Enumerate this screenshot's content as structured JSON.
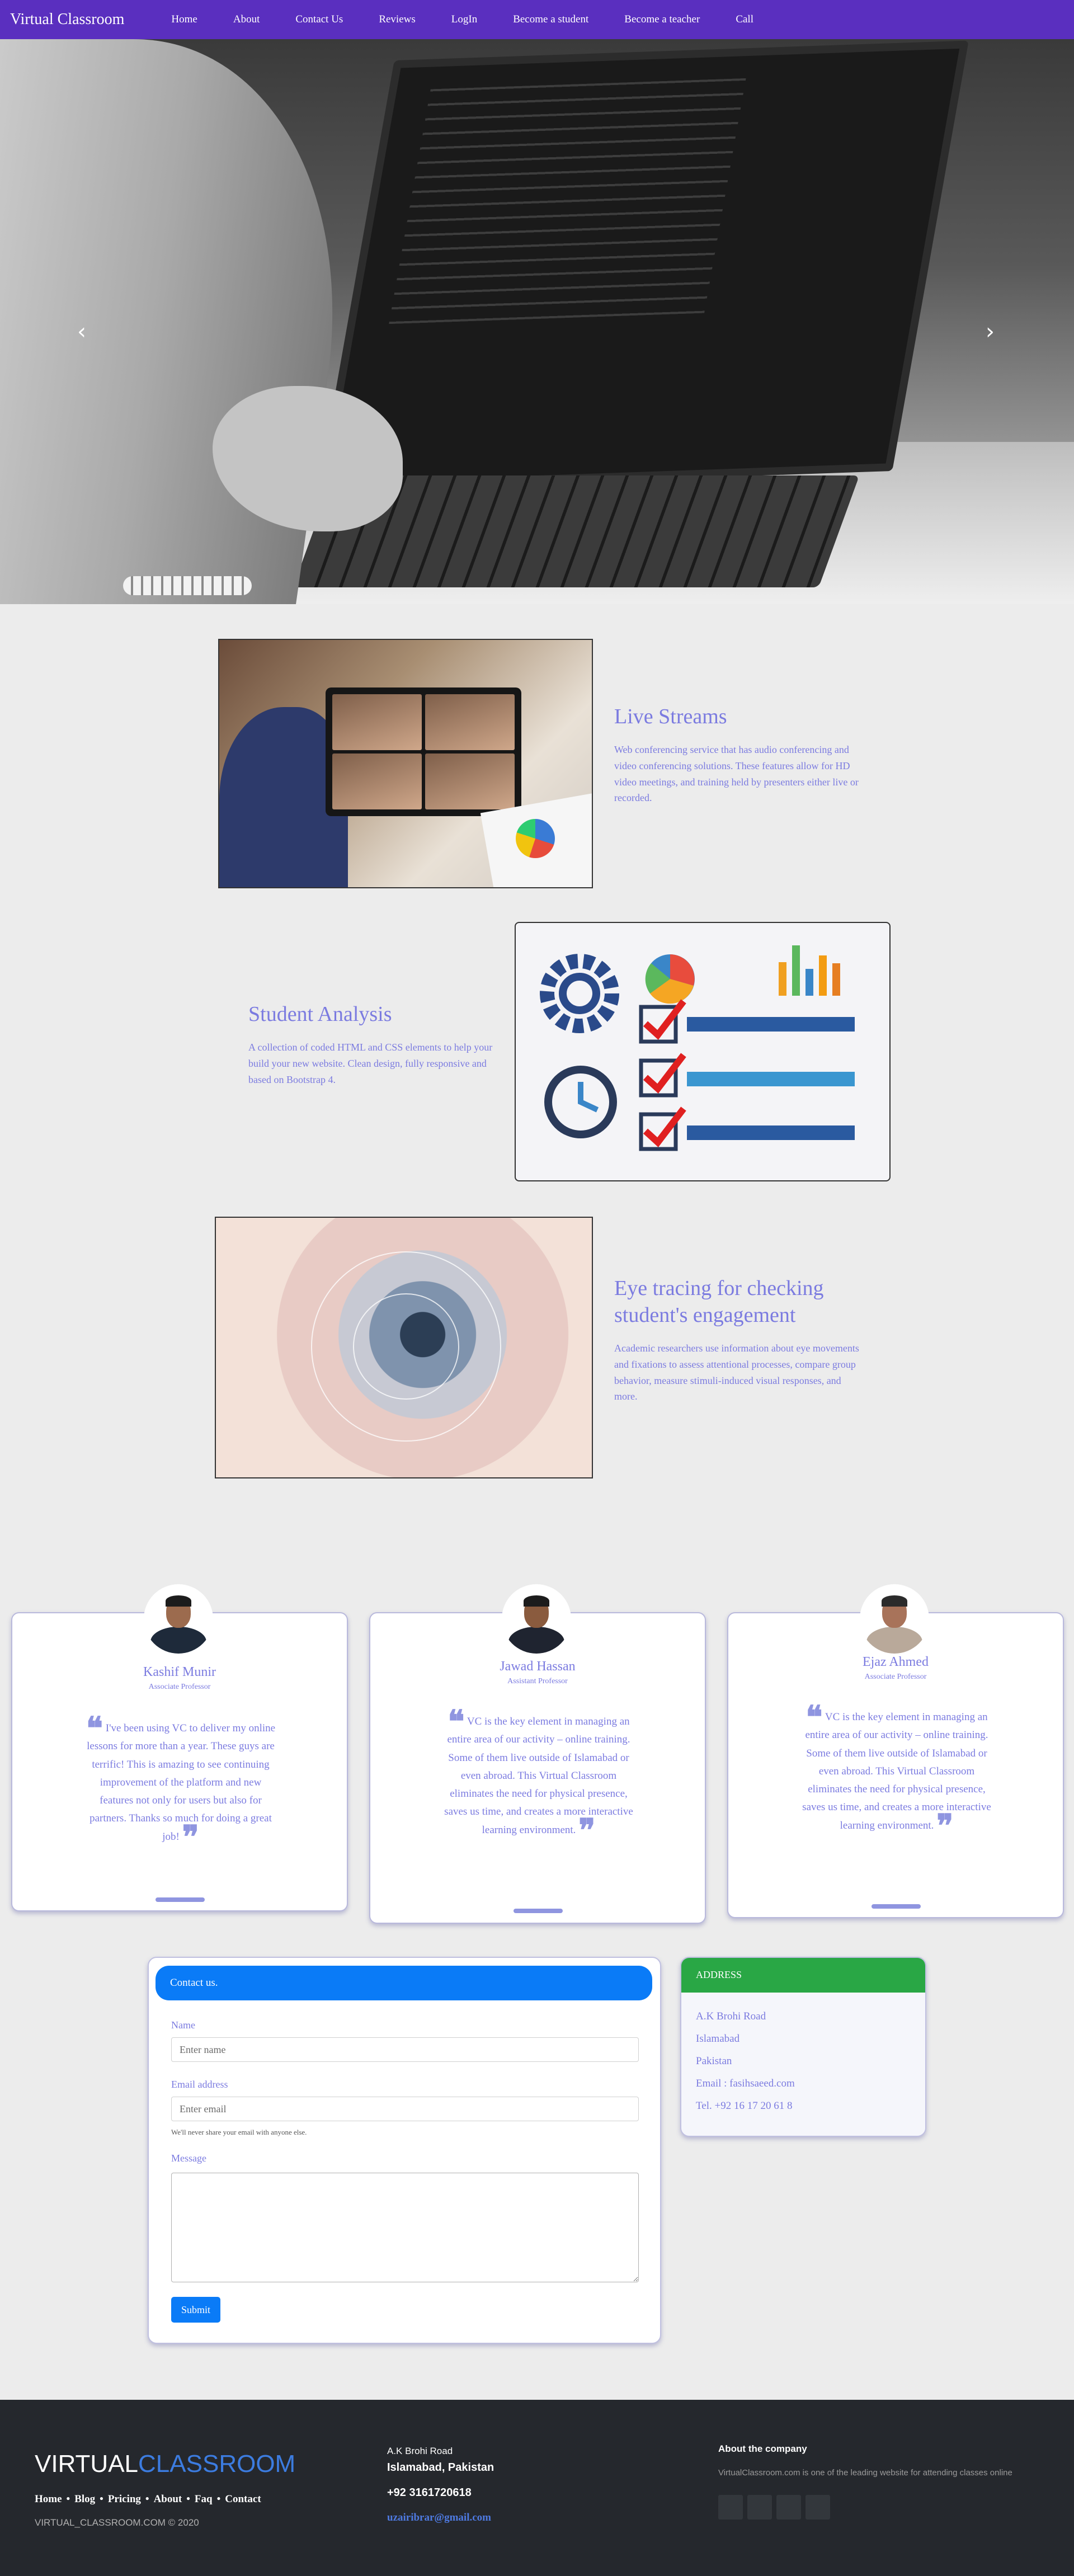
{
  "nav": {
    "brand": "Virtual Classroom",
    "links": [
      "Home",
      "About",
      "Contact Us",
      "Reviews",
      "LogIn",
      "Become a student",
      "Become a teacher",
      "Call"
    ]
  },
  "hero": {
    "next_arrow": "›",
    "prev_arrow": "‹"
  },
  "features": [
    {
      "title": "Live Streams",
      "text": "Web conferencing service that has audio conferencing and video conferencing solutions. These features allow for HD video meetings, and training held by presenters either live or recorded."
    },
    {
      "title": "Student Analysis",
      "text": "A collection of coded HTML and CSS elements to help your build your new website. Clean design, fully responsive and based on Bootstrap 4."
    },
    {
      "title": "Eye tracing for checking student's engagement",
      "text": "Academic researchers use information about eye movements and fixations to assess attentional processes, compare group behavior, measure stimuli-induced visual responses, and more."
    }
  ],
  "testimonials": [
    {
      "name": "Kashif Munir",
      "role": "Associate Professor",
      "quote": "I've been using VC to deliver my online lessons for more than a year. These guys are terrific! This is amazing to see continuing improvement of the platform and new features not only for users but also for partners. Thanks so much for doing a great job!"
    },
    {
      "name": "Jawad Hassan",
      "role": "Assistant Professor",
      "quote": "VC is the key element in managing an entire area of our activity – online training. Some of them live outside of Islamabad or even abroad. This Virtual Classroom eliminates the need for physical presence, saves us time, and creates a more interactive learning environment."
    },
    {
      "name": "Ejaz Ahmed",
      "role": "Associate Professor",
      "quote": "VC is the key element in managing an entire area of our activity – online training. Some of them live outside of Islamabad or even abroad. This Virtual Classroom eliminates the need for physical presence, saves us time, and creates a more interactive learning environment."
    }
  ],
  "contact": {
    "header": "Contact us.",
    "name_label": "Name",
    "name_placeholder": "Enter name",
    "email_label": "Email address",
    "email_placeholder": "Enter email",
    "email_help": "We'll never share your email with anyone else.",
    "message_label": "Message",
    "submit": "Submit"
  },
  "address": {
    "header": "ADDRESS",
    "lines": [
      "A.K Brohi Road",
      "Islamabad",
      "Pakistan",
      "Email : fasihsaeed.com",
      "Tel. +92 16 17 20 61 8"
    ]
  },
  "footer": {
    "logo_a": "VIRTUAL",
    "logo_b": "CLASSROOM",
    "links": [
      "Home",
      "Blog",
      "Pricing",
      "About",
      "Faq",
      "Contact"
    ],
    "copyright": "VIRTUAL_CLASSROOM.COM © 2020",
    "addr1": "A.K Brohi Road",
    "addr2": "Islamabad, Pakistan",
    "phone": "+92 3161720618",
    "email": "uzairibrar@gmail.com",
    "about_title": "About the company",
    "about_text": "VirtualClassroom.com is one of the leading website for attending classes online"
  }
}
